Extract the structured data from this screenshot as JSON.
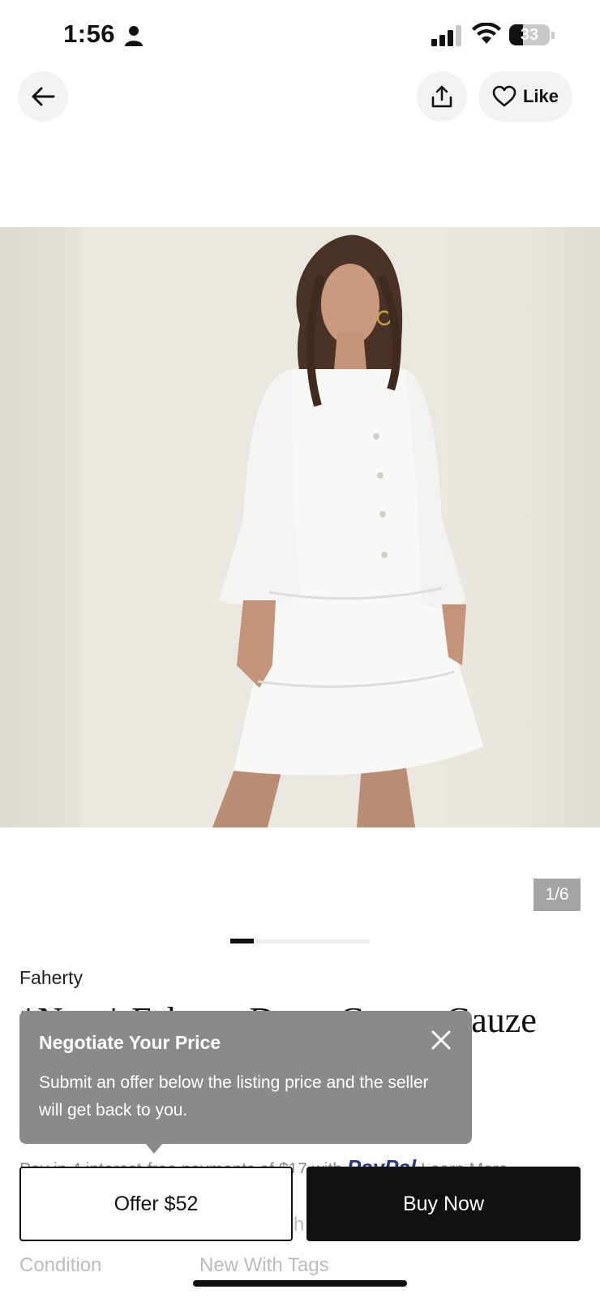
{
  "status_bar": {
    "time": "1:56",
    "battery": "33",
    "battery_level": 0.33
  },
  "header": {
    "back_icon": "arrow-left-icon",
    "share_icon": "share-upload-icon",
    "like_icon": "heart-outline-icon",
    "like_label": "Like"
  },
  "gallery": {
    "page_count": "1/6",
    "current_index": 1,
    "total": 6
  },
  "listing": {
    "brand": "Faherty",
    "title": "*New* Faherty Dress Cotton Gauze"
  },
  "tooltip": {
    "title": "Negotiate Your Price",
    "body": "Submit an offer below the listing price and the seller will get back to you.",
    "close_icon": "close-icon"
  },
  "payment": {
    "text_before": "Pay in 4 interest-free payments of $17 with",
    "logo": "PayPal",
    "learn_more": "Learn More"
  },
  "actions": {
    "offer_label": "Offer $52",
    "buy_label": "Buy Now"
  },
  "details": {
    "condition_label": "Condition",
    "condition_value": "New With Tags",
    "partial_text": "h"
  },
  "colors": {
    "tooltip_bg": "#8a8a8a",
    "primary_button": "#111111",
    "muted_text": "#bcbcbc"
  }
}
